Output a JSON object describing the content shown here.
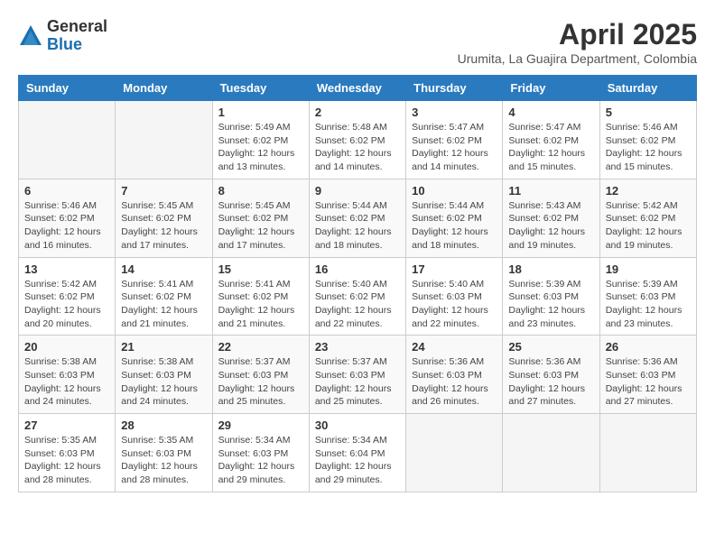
{
  "logo": {
    "general": "General",
    "blue": "Blue"
  },
  "title": "April 2025",
  "location": "Urumita, La Guajira Department, Colombia",
  "weekdays": [
    "Sunday",
    "Monday",
    "Tuesday",
    "Wednesday",
    "Thursday",
    "Friday",
    "Saturday"
  ],
  "weeks": [
    [
      {
        "day": "",
        "info": ""
      },
      {
        "day": "",
        "info": ""
      },
      {
        "day": "1",
        "info": "Sunrise: 5:49 AM\nSunset: 6:02 PM\nDaylight: 12 hours and 13 minutes."
      },
      {
        "day": "2",
        "info": "Sunrise: 5:48 AM\nSunset: 6:02 PM\nDaylight: 12 hours and 14 minutes."
      },
      {
        "day": "3",
        "info": "Sunrise: 5:47 AM\nSunset: 6:02 PM\nDaylight: 12 hours and 14 minutes."
      },
      {
        "day": "4",
        "info": "Sunrise: 5:47 AM\nSunset: 6:02 PM\nDaylight: 12 hours and 15 minutes."
      },
      {
        "day": "5",
        "info": "Sunrise: 5:46 AM\nSunset: 6:02 PM\nDaylight: 12 hours and 15 minutes."
      }
    ],
    [
      {
        "day": "6",
        "info": "Sunrise: 5:46 AM\nSunset: 6:02 PM\nDaylight: 12 hours and 16 minutes."
      },
      {
        "day": "7",
        "info": "Sunrise: 5:45 AM\nSunset: 6:02 PM\nDaylight: 12 hours and 17 minutes."
      },
      {
        "day": "8",
        "info": "Sunrise: 5:45 AM\nSunset: 6:02 PM\nDaylight: 12 hours and 17 minutes."
      },
      {
        "day": "9",
        "info": "Sunrise: 5:44 AM\nSunset: 6:02 PM\nDaylight: 12 hours and 18 minutes."
      },
      {
        "day": "10",
        "info": "Sunrise: 5:44 AM\nSunset: 6:02 PM\nDaylight: 12 hours and 18 minutes."
      },
      {
        "day": "11",
        "info": "Sunrise: 5:43 AM\nSunset: 6:02 PM\nDaylight: 12 hours and 19 minutes."
      },
      {
        "day": "12",
        "info": "Sunrise: 5:42 AM\nSunset: 6:02 PM\nDaylight: 12 hours and 19 minutes."
      }
    ],
    [
      {
        "day": "13",
        "info": "Sunrise: 5:42 AM\nSunset: 6:02 PM\nDaylight: 12 hours and 20 minutes."
      },
      {
        "day": "14",
        "info": "Sunrise: 5:41 AM\nSunset: 6:02 PM\nDaylight: 12 hours and 21 minutes."
      },
      {
        "day": "15",
        "info": "Sunrise: 5:41 AM\nSunset: 6:02 PM\nDaylight: 12 hours and 21 minutes."
      },
      {
        "day": "16",
        "info": "Sunrise: 5:40 AM\nSunset: 6:02 PM\nDaylight: 12 hours and 22 minutes."
      },
      {
        "day": "17",
        "info": "Sunrise: 5:40 AM\nSunset: 6:03 PM\nDaylight: 12 hours and 22 minutes."
      },
      {
        "day": "18",
        "info": "Sunrise: 5:39 AM\nSunset: 6:03 PM\nDaylight: 12 hours and 23 minutes."
      },
      {
        "day": "19",
        "info": "Sunrise: 5:39 AM\nSunset: 6:03 PM\nDaylight: 12 hours and 23 minutes."
      }
    ],
    [
      {
        "day": "20",
        "info": "Sunrise: 5:38 AM\nSunset: 6:03 PM\nDaylight: 12 hours and 24 minutes."
      },
      {
        "day": "21",
        "info": "Sunrise: 5:38 AM\nSunset: 6:03 PM\nDaylight: 12 hours and 24 minutes."
      },
      {
        "day": "22",
        "info": "Sunrise: 5:37 AM\nSunset: 6:03 PM\nDaylight: 12 hours and 25 minutes."
      },
      {
        "day": "23",
        "info": "Sunrise: 5:37 AM\nSunset: 6:03 PM\nDaylight: 12 hours and 25 minutes."
      },
      {
        "day": "24",
        "info": "Sunrise: 5:36 AM\nSunset: 6:03 PM\nDaylight: 12 hours and 26 minutes."
      },
      {
        "day": "25",
        "info": "Sunrise: 5:36 AM\nSunset: 6:03 PM\nDaylight: 12 hours and 27 minutes."
      },
      {
        "day": "26",
        "info": "Sunrise: 5:36 AM\nSunset: 6:03 PM\nDaylight: 12 hours and 27 minutes."
      }
    ],
    [
      {
        "day": "27",
        "info": "Sunrise: 5:35 AM\nSunset: 6:03 PM\nDaylight: 12 hours and 28 minutes."
      },
      {
        "day": "28",
        "info": "Sunrise: 5:35 AM\nSunset: 6:03 PM\nDaylight: 12 hours and 28 minutes."
      },
      {
        "day": "29",
        "info": "Sunrise: 5:34 AM\nSunset: 6:03 PM\nDaylight: 12 hours and 29 minutes."
      },
      {
        "day": "30",
        "info": "Sunrise: 5:34 AM\nSunset: 6:04 PM\nDaylight: 12 hours and 29 minutes."
      },
      {
        "day": "",
        "info": ""
      },
      {
        "day": "",
        "info": ""
      },
      {
        "day": "",
        "info": ""
      }
    ]
  ]
}
